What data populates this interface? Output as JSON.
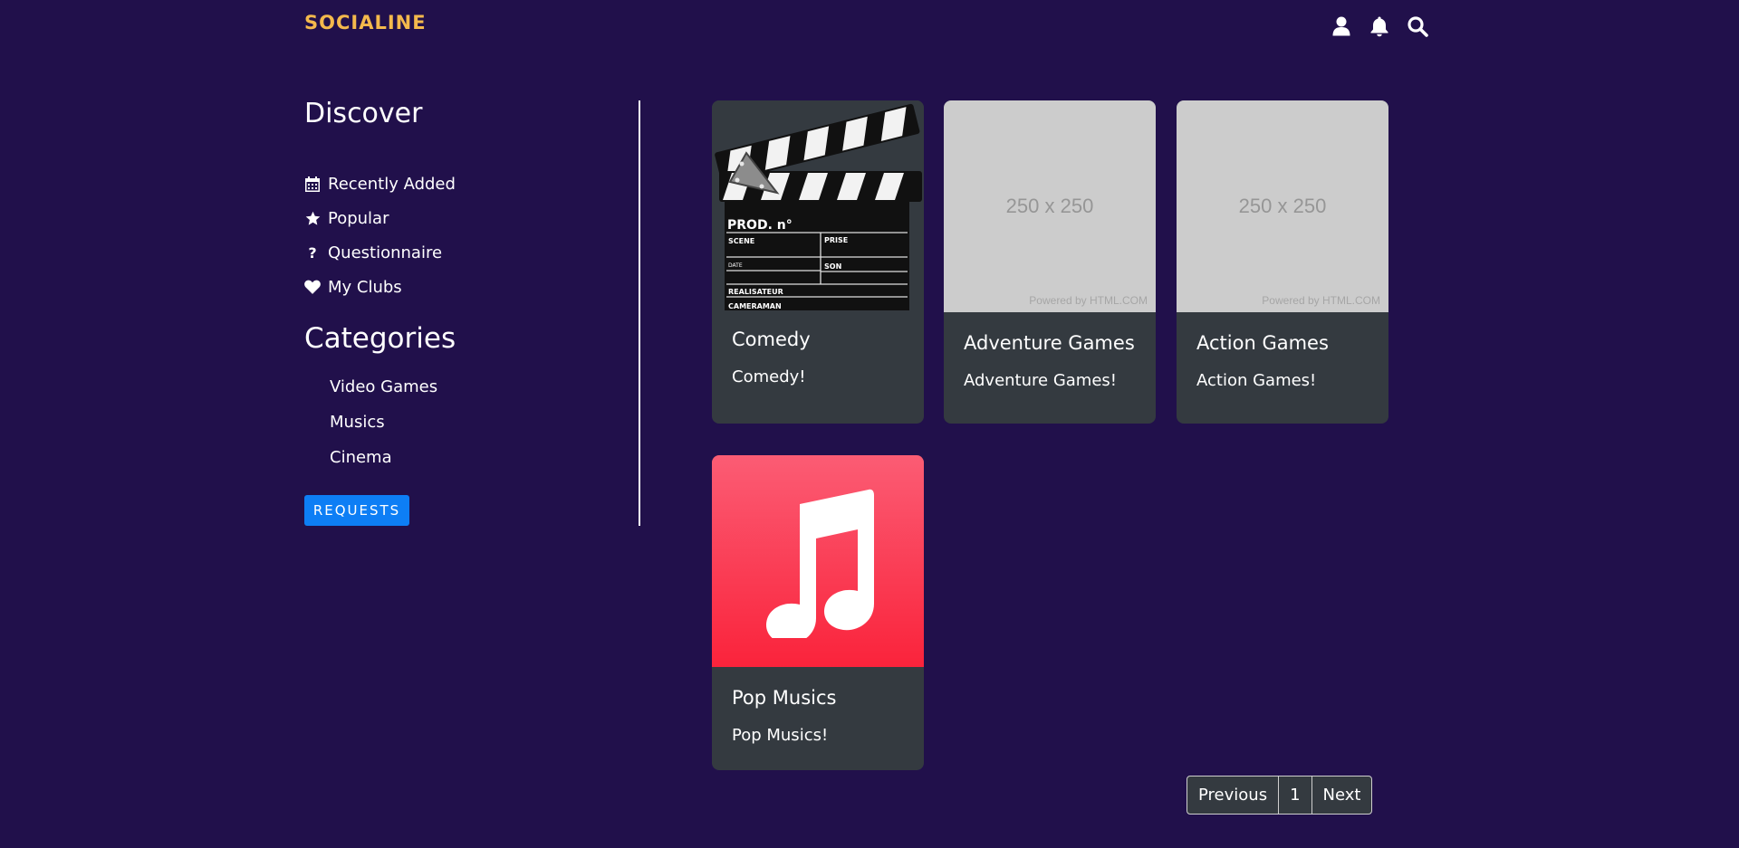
{
  "header": {
    "brand": "SOCIALINE",
    "icons": [
      "user-icon",
      "bell-icon",
      "search-icon"
    ]
  },
  "sidebar": {
    "discover_title": "Discover",
    "discover_items": [
      {
        "label": "Recently Added",
        "icon": "calendar-icon"
      },
      {
        "label": "Popular",
        "icon": "star-icon"
      },
      {
        "label": "Questionnaire",
        "icon": "question-icon"
      },
      {
        "label": "My Clubs",
        "icon": "heart-icon"
      }
    ],
    "categories_title": "Categories",
    "categories": [
      {
        "label": "Video Games"
      },
      {
        "label": "Musics"
      },
      {
        "label": "Cinema"
      }
    ],
    "requests_label": "REQUESTS"
  },
  "clubs": [
    {
      "title": "Comedy",
      "text": "Comedy!",
      "image": "clapperboard",
      "clapper_text": {
        "prod": "PROD. n°",
        "scene": "SCENE",
        "prise": "PRISE",
        "date": "DATE",
        "son": "SON",
        "realisateur": "REALISATEUR",
        "cameraman": "CAMERAMAN"
      }
    },
    {
      "title": "Adventure Games",
      "text": "Adventure Games!",
      "image": "placeholder",
      "placeholder_size": "250 x 250",
      "placeholder_powered": "Powered by HTML.COM"
    },
    {
      "title": "Action Games",
      "text": "Action Games!",
      "image": "placeholder",
      "placeholder_size": "250 x 250",
      "placeholder_powered": "Powered by HTML.COM"
    },
    {
      "title": "Pop Musics",
      "text": "Pop Musics!",
      "image": "music-note"
    }
  ],
  "pagination": {
    "previous": "Previous",
    "current": "1",
    "next": "Next"
  },
  "colors": {
    "background": "#21104b",
    "brand": "#f4b94c",
    "card": "#343a40",
    "button": "#0d7ef5"
  }
}
